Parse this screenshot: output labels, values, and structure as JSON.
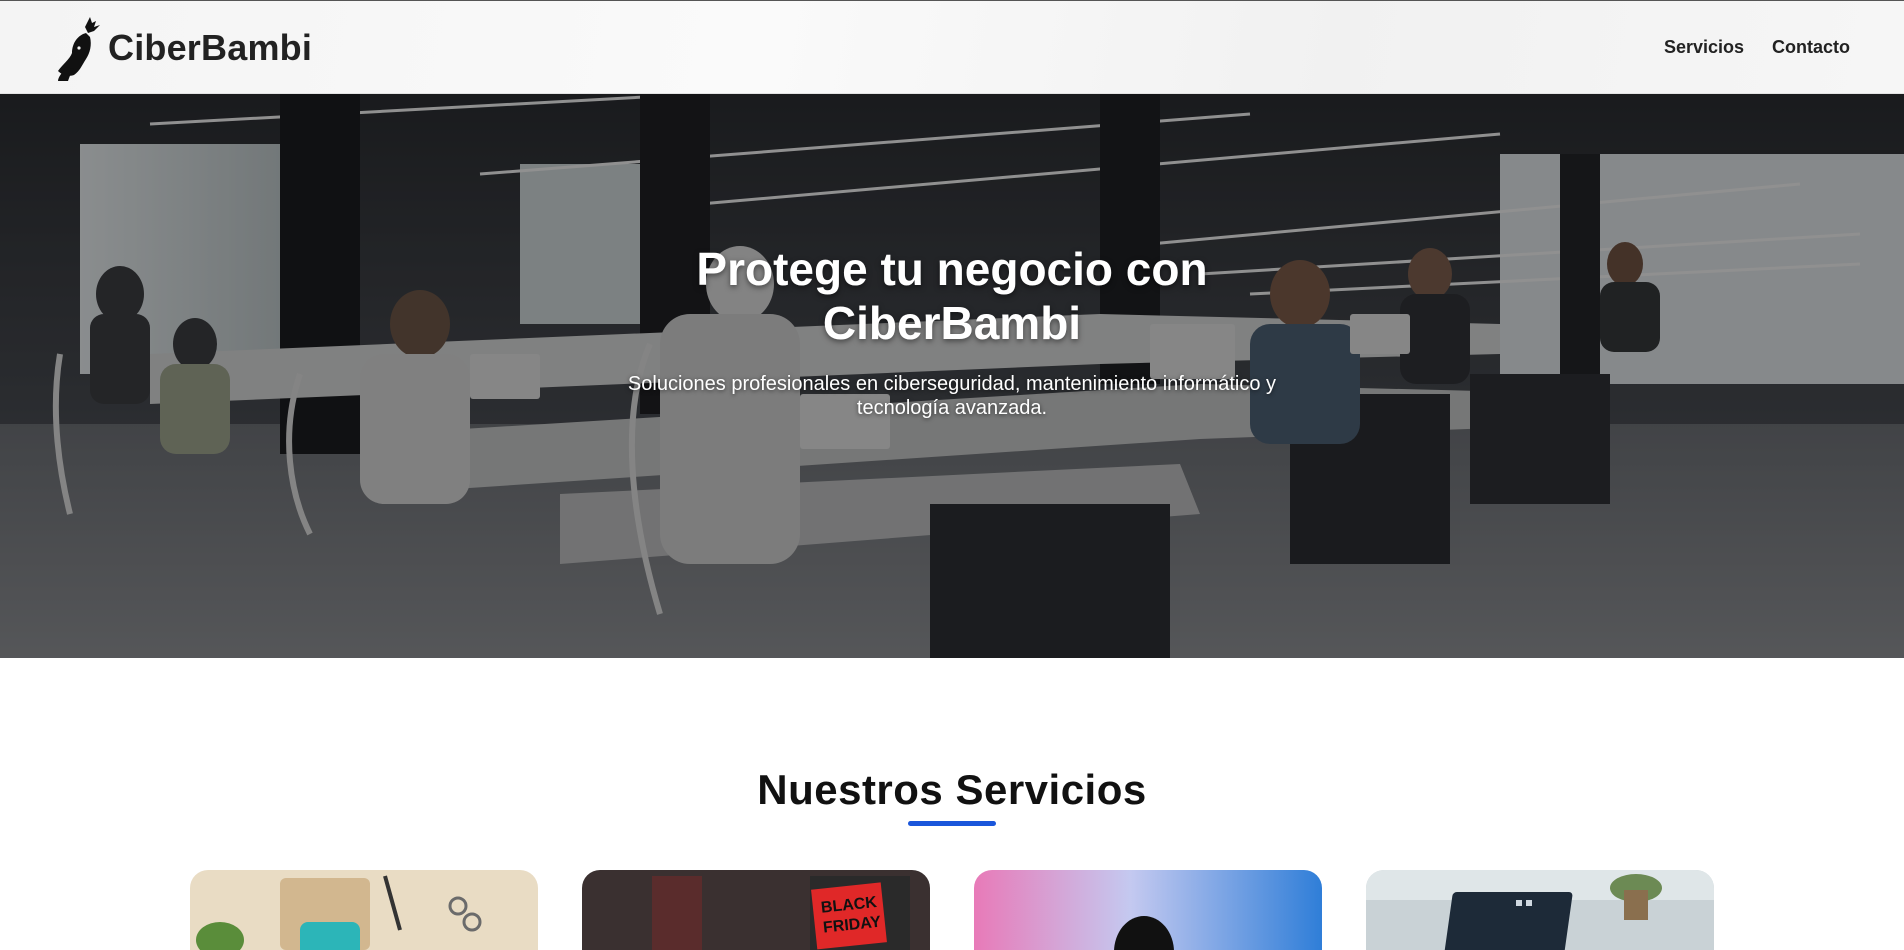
{
  "header": {
    "brand": "CiberBambi",
    "logo_icon": "deer-head-icon",
    "nav": [
      {
        "label": "Servicios"
      },
      {
        "label": "Contacto"
      }
    ]
  },
  "hero": {
    "title": "Protege tu negocio con CiberBambi",
    "subtitle": "Soluciones profesionales en ciberseguridad, mantenimiento informático y tecnología avanzada."
  },
  "services": {
    "title": "Nuestros Servicios",
    "accent_color": "#1a56db",
    "cards": [
      {
        "image": "workspace-photo"
      },
      {
        "image": "black-friday-store-photo"
      },
      {
        "image": "gradient-silhouette-photo"
      },
      {
        "image": "laptop-dashboard-photo"
      }
    ]
  }
}
